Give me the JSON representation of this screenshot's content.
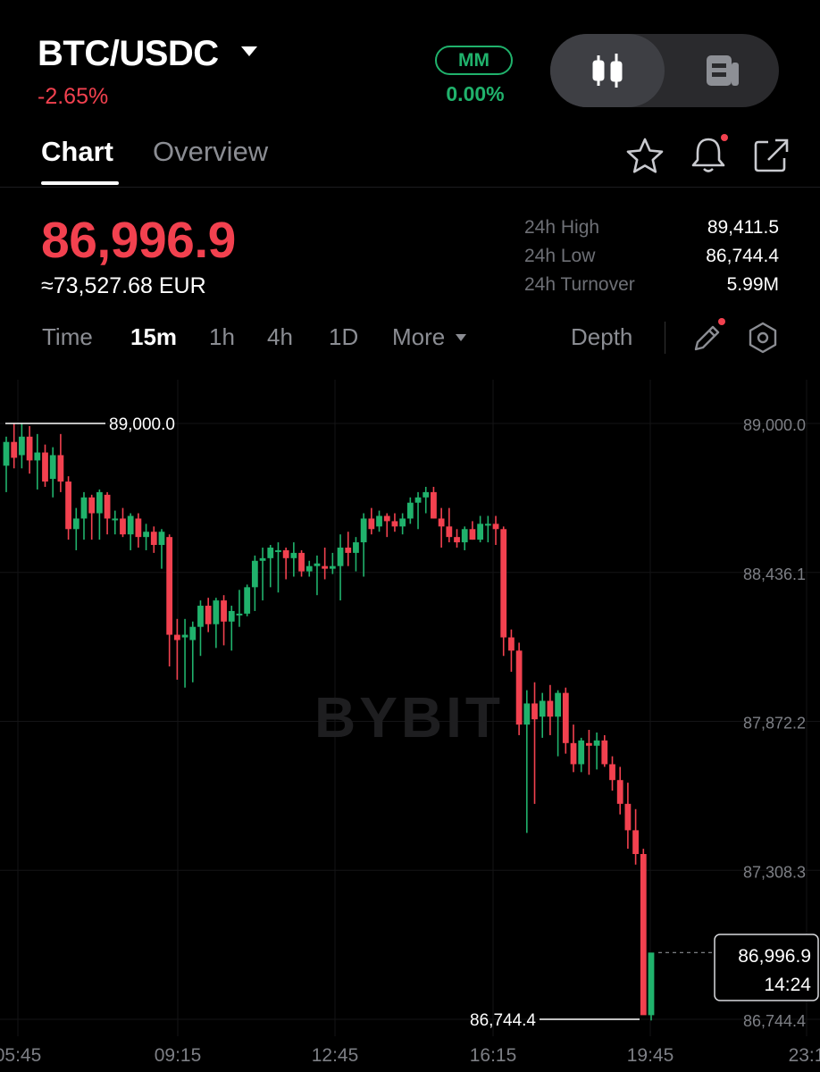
{
  "header": {
    "pair": "BTC/USDC",
    "change_pct": "-2.65%",
    "mm_label": "MM",
    "mm_value": "0.00%"
  },
  "tabs": [
    "Chart",
    "Overview"
  ],
  "price": {
    "last": "86,996.9",
    "fiat": "≈73,527.68 EUR"
  },
  "stats": [
    {
      "label": "24h High",
      "value": "89,411.5"
    },
    {
      "label": "24h Low",
      "value": "86,744.4"
    },
    {
      "label": "24h Turnover",
      "value": "5.99M"
    }
  ],
  "timeframes": [
    "Time",
    "15m",
    "1h",
    "4h",
    "1D",
    "More"
  ],
  "selected_timeframe": "15m",
  "depth_label": "Depth",
  "icons": [
    "star-icon",
    "bell-icon",
    "share-icon",
    "candlestick-icon",
    "document-icon",
    "pencil-icon",
    "settings-hexagon-icon"
  ],
  "colors": {
    "up": "#20b26c",
    "down": "#f2414f",
    "background": "#000000"
  },
  "chart_data": {
    "type": "candlestick",
    "watermark": "BYBIT",
    "y_ticks": [
      "89,000.0",
      "88,436.1",
      "87,872.2",
      "87,308.3",
      "86,744.4"
    ],
    "y_tick_values": [
      89000.0,
      88436.1,
      87872.2,
      87308.3,
      86744.4
    ],
    "x_ticks": [
      "05:45",
      "09:15",
      "12:45",
      "16:15",
      "19:45",
      "23:1"
    ],
    "high_marker": "89,000.0",
    "low_marker": "86,744.4",
    "last_price": "86,996.9",
    "countdown": "14:24",
    "candles": [
      [
        88840,
        88950,
        88740,
        88930
      ],
      [
        88930,
        89000,
        88830,
        88870
      ],
      [
        88880,
        89000,
        88830,
        88950
      ],
      [
        88950,
        88990,
        88810,
        88860
      ],
      [
        88860,
        88960,
        88750,
        88890
      ],
      [
        88890,
        88920,
        88760,
        88780
      ],
      [
        88790,
        88910,
        88720,
        88880
      ],
      [
        88880,
        88960,
        88740,
        88780
      ],
      [
        88780,
        88800,
        88560,
        88600
      ],
      [
        88600,
        88680,
        88520,
        88640
      ],
      [
        88640,
        88740,
        88560,
        88720
      ],
      [
        88720,
        88730,
        88560,
        88660
      ],
      [
        88660,
        88750,
        88560,
        88740
      ],
      [
        88730,
        88740,
        88580,
        88640
      ],
      [
        88640,
        88670,
        88580,
        88640
      ],
      [
        88640,
        88680,
        88570,
        88580
      ],
      [
        88580,
        88660,
        88520,
        88650
      ],
      [
        88640,
        88660,
        88530,
        88570
      ],
      [
        88570,
        88620,
        88520,
        88590
      ],
      [
        88590,
        88610,
        88510,
        88540
      ],
      [
        88540,
        88600,
        88450,
        88590
      ],
      [
        88570,
        88580,
        88080,
        88200
      ],
      [
        88200,
        88260,
        88030,
        88180
      ],
      [
        88190,
        88260,
        88000,
        88200
      ],
      [
        88180,
        88250,
        88020,
        88230
      ],
      [
        88230,
        88330,
        88120,
        88310
      ],
      [
        88310,
        88340,
        88210,
        88240
      ],
      [
        88240,
        88340,
        88150,
        88330
      ],
      [
        88330,
        88350,
        88160,
        88250
      ],
      [
        88250,
        88310,
        88140,
        88290
      ],
      [
        88280,
        88370,
        88230,
        88280
      ],
      [
        88280,
        88390,
        88270,
        88380
      ],
      [
        88380,
        88500,
        88290,
        88480
      ],
      [
        88480,
        88530,
        88330,
        88490
      ],
      [
        88490,
        88540,
        88380,
        88530
      ],
      [
        88520,
        88550,
        88360,
        88520
      ],
      [
        88520,
        88530,
        88410,
        88490
      ],
      [
        88490,
        88550,
        88420,
        88510
      ],
      [
        88510,
        88520,
        88420,
        88440
      ],
      [
        88440,
        88480,
        88420,
        88460
      ],
      [
        88460,
        88500,
        88350,
        88470
      ],
      [
        88460,
        88530,
        88410,
        88450
      ],
      [
        88450,
        88510,
        88430,
        88460
      ],
      [
        88460,
        88580,
        88330,
        88530
      ],
      [
        88530,
        88590,
        88460,
        88510
      ],
      [
        88510,
        88570,
        88440,
        88550
      ],
      [
        88550,
        88660,
        88420,
        88640
      ],
      [
        88640,
        88680,
        88580,
        88600
      ],
      [
        88610,
        88670,
        88590,
        88650
      ],
      [
        88650,
        88660,
        88570,
        88630
      ],
      [
        88630,
        88660,
        88590,
        88610
      ],
      [
        88610,
        88660,
        88580,
        88640
      ],
      [
        88640,
        88720,
        88620,
        88700
      ],
      [
        88700,
        88740,
        88600,
        88720
      ],
      [
        88720,
        88760,
        88660,
        88740
      ],
      [
        88740,
        88760,
        88640,
        88640
      ],
      [
        88640,
        88680,
        88530,
        88610
      ],
      [
        88610,
        88680,
        88550,
        88570
      ],
      [
        88570,
        88600,
        88530,
        88550
      ],
      [
        88550,
        88610,
        88520,
        88600
      ],
      [
        88600,
        88630,
        88560,
        88560
      ],
      [
        88560,
        88650,
        88550,
        88620
      ],
      [
        88620,
        88650,
        88550,
        88620
      ],
      [
        88620,
        88650,
        88540,
        88600
      ],
      [
        88600,
        88610,
        88120,
        88190
      ],
      [
        88190,
        88220,
        88060,
        88140
      ],
      [
        88140,
        88170,
        87820,
        87860
      ],
      [
        87860,
        87990,
        87450,
        87940
      ],
      [
        87940,
        88020,
        87560,
        87880
      ],
      [
        87890,
        87980,
        87810,
        87950
      ],
      [
        87950,
        88010,
        87820,
        87890
      ],
      [
        87890,
        87990,
        87740,
        87980
      ],
      [
        87980,
        88000,
        87750,
        87790
      ],
      [
        87790,
        87860,
        87680,
        87710
      ],
      [
        87710,
        87810,
        87680,
        87800
      ],
      [
        87790,
        87840,
        87670,
        87780
      ],
      [
        87780,
        87830,
        87690,
        87800
      ],
      [
        87800,
        87820,
        87700,
        87710
      ],
      [
        87710,
        87740,
        87610,
        87650
      ],
      [
        87650,
        87700,
        87520,
        87560
      ],
      [
        87560,
        87640,
        87390,
        87460
      ],
      [
        87460,
        87540,
        87330,
        87370
      ],
      [
        87370,
        87390,
        86790,
        86760
      ],
      [
        86760,
        86990,
        86740,
        86997
      ]
    ]
  }
}
